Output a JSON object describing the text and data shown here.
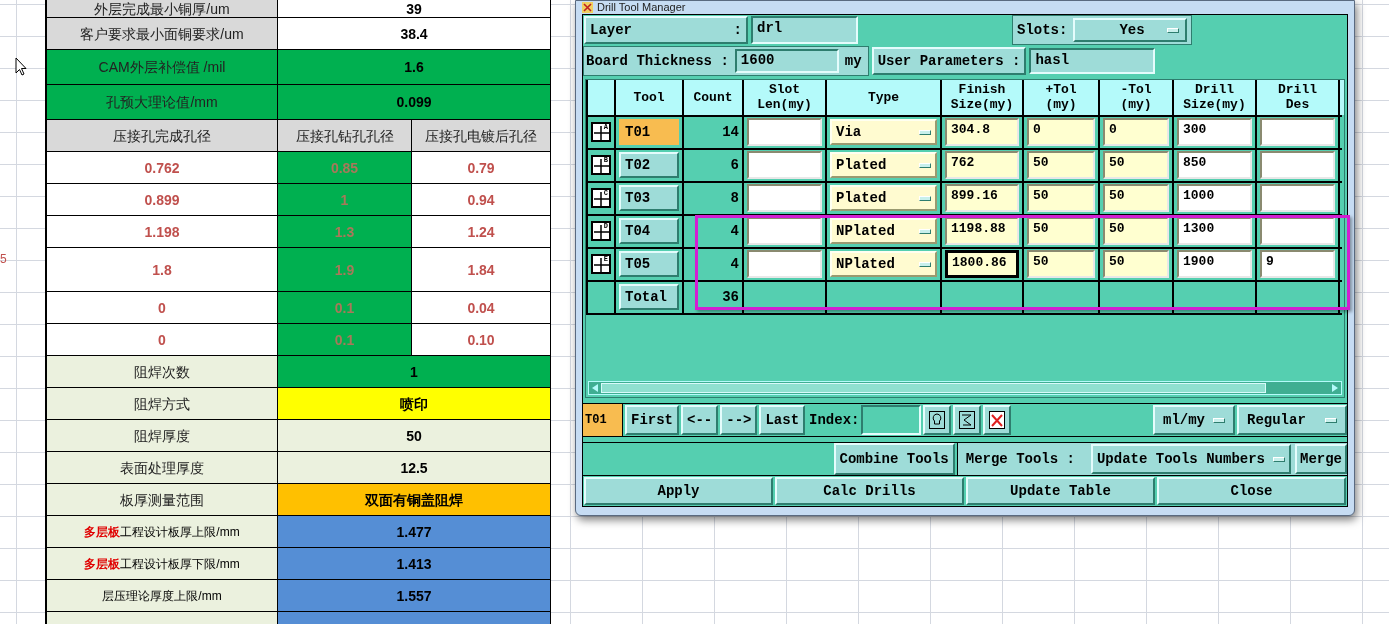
{
  "sheet": {
    "side_mark": "5",
    "rows": [
      {
        "kind": "pair",
        "cells": [
          {
            "text": "外层完成最小铜厚/um",
            "color": "#d9d9d9"
          },
          {
            "text": "39",
            "color": "#ffffff"
          }
        ]
      },
      {
        "kind": "pair",
        "cells": [
          {
            "text": "客户要求最小面铜要求/um",
            "color": "#d9d9d9"
          },
          {
            "text": "38.4",
            "color": "#ffffff"
          }
        ]
      },
      {
        "kind": "pair",
        "cells": [
          {
            "text": "CAM外层补偿值 /mil",
            "color": "#00b050"
          },
          {
            "text": "1.6",
            "color": "#00b050"
          }
        ]
      },
      {
        "kind": "pair",
        "cells": [
          {
            "text": "孔预大理论值/mm",
            "color": "#00b050"
          },
          {
            "text": "0.099",
            "color": "#00b050"
          }
        ]
      },
      {
        "kind": "header",
        "cells": [
          {
            "text": "压接孔完成孔径",
            "color": "#d9d9d9"
          },
          {
            "text": "压接孔钻孔孔径",
            "color": "#d9d9d9"
          },
          {
            "text": "压接孔电镀后孔径",
            "color": "#d9d9d9"
          }
        ]
      },
      {
        "kind": "numbers",
        "cells": [
          {
            "text": "0.762",
            "color": "#ffffff"
          },
          {
            "text": "0.85",
            "color": "#00b050"
          },
          {
            "text": "0.79",
            "color": "#ffffff"
          }
        ]
      },
      {
        "kind": "numbers",
        "cells": [
          {
            "text": "0.899",
            "color": "#ffffff"
          },
          {
            "text": "1",
            "color": "#00b050"
          },
          {
            "text": "0.94",
            "color": "#ffffff"
          }
        ]
      },
      {
        "kind": "numbers",
        "cells": [
          {
            "text": "1.198",
            "color": "#ffffff"
          },
          {
            "text": "1.3",
            "color": "#00b050"
          },
          {
            "text": "1.24",
            "color": "#ffffff"
          }
        ]
      },
      {
        "kind": "numbers",
        "cells": [
          {
            "text": "1.8",
            "color": "#ffffff"
          },
          {
            "text": "1.9",
            "color": "#00b050"
          },
          {
            "text": "1.84",
            "color": "#ffffff"
          }
        ]
      },
      {
        "kind": "numbers",
        "cells": [
          {
            "text": "0",
            "color": "#ffffff"
          },
          {
            "text": "0.1",
            "color": "#00b050"
          },
          {
            "text": "0.04",
            "color": "#ffffff"
          }
        ]
      },
      {
        "kind": "numbers",
        "cells": [
          {
            "text": "0",
            "color": "#ffffff"
          },
          {
            "text": "0.1",
            "color": "#00b050"
          },
          {
            "text": "0.10",
            "color": "#ffffff"
          }
        ]
      },
      {
        "kind": "pair",
        "cells": [
          {
            "text": "阻焊次数",
            "color": "#ebf1de"
          },
          {
            "text": "1",
            "color": "#00b050"
          }
        ]
      },
      {
        "kind": "pair",
        "cells": [
          {
            "text": "阻焊方式",
            "color": "#ebf1de"
          },
          {
            "text": "喷印",
            "color": "#ffff00"
          }
        ]
      },
      {
        "kind": "pair",
        "cells": [
          {
            "text": "阻焊厚度",
            "color": "#ebf1de"
          },
          {
            "text": "50",
            "color": "#ebf1de"
          }
        ]
      },
      {
        "kind": "pair",
        "cells": [
          {
            "text": "表面处理厚度",
            "color": "#ebf1de"
          },
          {
            "text": "12.5",
            "color": "#ebf1de"
          }
        ]
      },
      {
        "kind": "pair",
        "cells": [
          {
            "text": "板厚测量范围",
            "color": "#ebf1de"
          },
          {
            "text": "双面有铜盖阻焊",
            "color": "#ffc000"
          }
        ]
      },
      {
        "kind": "pair",
        "cells": [
          {
            "prefix": "多层板",
            "text": "工程设计板厚上限/mm",
            "color": "#ebf1de"
          },
          {
            "text": "1.477",
            "color": "#558ed5"
          }
        ]
      },
      {
        "kind": "pair",
        "cells": [
          {
            "prefix": "多层板",
            "text": "工程设计板厚下限/mm",
            "color": "#ebf1de"
          },
          {
            "text": "1.413",
            "color": "#558ed5"
          }
        ]
      },
      {
        "kind": "pair",
        "cells": [
          {
            "text": "层压理论厚度上限/mm",
            "color": "#ebf1de"
          },
          {
            "text": "1.557",
            "color": "#558ed5"
          }
        ]
      },
      {
        "kind": "pair",
        "cells": [
          {
            "color": "#ebf1de"
          },
          {
            "color": "#558ed5"
          }
        ]
      }
    ]
  },
  "dialog": {
    "title": "Drill Tool Manager",
    "layer": {
      "label": "Layer",
      "separator": ":",
      "value": "drl"
    },
    "slots": {
      "label": "Slots:",
      "value": "Yes"
    },
    "board_thickness": {
      "label": "Board Thickness :",
      "value": "1600",
      "unit": "my"
    },
    "user_parameters": {
      "label": "User Parameters :",
      "value": "hasl"
    },
    "columns": [
      [
        "Tool"
      ],
      [
        "Count"
      ],
      [
        "Slot",
        "Len(my)"
      ],
      [
        "Type"
      ],
      [
        "Finish",
        "Size(my)"
      ],
      [
        "+Tol",
        "(my)"
      ],
      [
        "-Tol",
        "(my)"
      ],
      [
        "Drill",
        "Size(my)"
      ],
      [
        "Drill",
        "Des"
      ]
    ],
    "rows": [
      {
        "marker": "A",
        "tool": "T01",
        "selected": true,
        "count": "14",
        "type": "Via",
        "finish": "304.8",
        "plus_tol": "0",
        "minus_tol": "0",
        "drill_size": "300",
        "focused": false
      },
      {
        "marker": "B",
        "tool": "T02",
        "selected": false,
        "count": "6",
        "type": "Plated",
        "finish": "762",
        "plus_tol": "50",
        "minus_tol": "50",
        "drill_size": "850",
        "focused": false
      },
      {
        "marker": "C",
        "tool": "T03",
        "selected": false,
        "count": "8",
        "type": "Plated",
        "finish": "899.16",
        "plus_tol": "50",
        "minus_tol": "50",
        "drill_size": "1000",
        "focused": false
      },
      {
        "marker": "D",
        "tool": "T04",
        "selected": false,
        "count": "4",
        "type": "NPlated",
        "finish": "1198.88",
        "plus_tol": "50",
        "minus_tol": "50",
        "drill_size": "1300",
        "focused": false
      },
      {
        "marker": "E",
        "tool": "T05",
        "selected": false,
        "count": "4",
        "type": "NPlated",
        "finish": "1800.86",
        "plus_tol": "50",
        "minus_tol": "50",
        "drill_size": "1900",
        "drill_des": "9",
        "focused": true
      }
    ],
    "total": {
      "label": "Total",
      "count": "36"
    },
    "toolbar": {
      "current_tool": "T01",
      "nav": [
        "First",
        "<--",
        "-->",
        "Last"
      ],
      "index_label": "Index:",
      "units": "ml/my",
      "mode": "Regular"
    },
    "merge_row": {
      "combine": "Combine Tools",
      "merge_label": "Merge Tools :",
      "merge_mode": "Update Tools Numbers",
      "merge": "Merge"
    },
    "actions": [
      "Apply",
      "Calc Drills",
      "Update Table",
      "Close"
    ]
  }
}
